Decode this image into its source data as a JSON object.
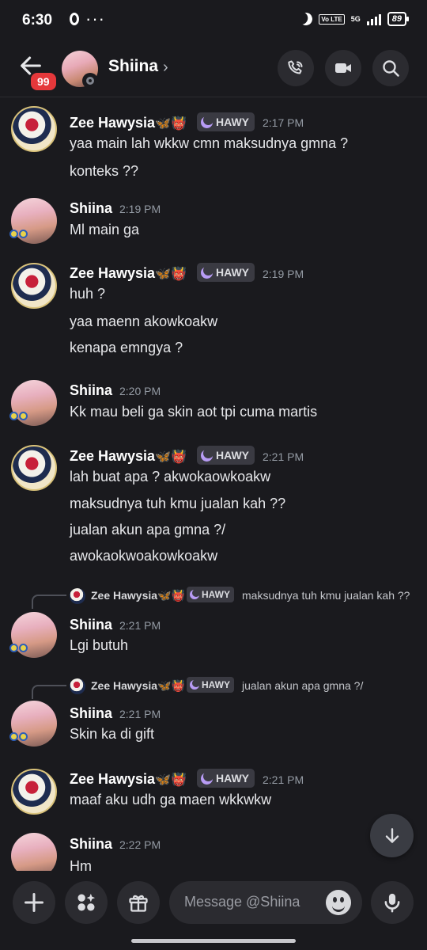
{
  "status_bar": {
    "time": "6:30",
    "dots": "···",
    "volte": "Vo LTE",
    "network": "5G",
    "battery": "89"
  },
  "header": {
    "back_badge": "99",
    "title": "Shiina",
    "chevron": "›"
  },
  "messages": [
    {
      "author": "Zee Hawysia",
      "emoji": "🦋👹",
      "tag": "HAWY",
      "time": "2:17 PM",
      "lines": [
        "yaa main lah wkkw cmn maksudnya gmna ?",
        "konteks ??"
      ]
    },
    {
      "author": "Shiina",
      "time": "2:19 PM",
      "lines": [
        "Ml main ga"
      ]
    },
    {
      "author": "Zee Hawysia",
      "emoji": "🦋👹",
      "tag": "HAWY",
      "time": "2:19 PM",
      "lines": [
        "huh ?",
        "yaa maenn akowkoakw",
        "kenapa emngya ?"
      ]
    },
    {
      "author": "Shiina",
      "time": "2:20 PM",
      "lines": [
        "Kk mau beli ga skin aot tpi cuma martis"
      ]
    },
    {
      "author": "Zee Hawysia",
      "emoji": "🦋👹",
      "tag": "HAWY",
      "time": "2:21 PM",
      "lines": [
        "lah buat apa ? akwokaowkoakw",
        "maksudnya tuh kmu jualan kah ??",
        "jualan akun apa gmna ?/",
        "awokaokwoakowkoakw"
      ]
    },
    {
      "author": "Shiina",
      "time": "2:21 PM",
      "lines": [
        "Lgi butuh"
      ],
      "reply": {
        "author": "Zee Hawysia",
        "emoji": "🦋👹",
        "tag": "HAWY",
        "text": "maksudnya tuh kmu jualan kah ??"
      }
    },
    {
      "author": "Shiina",
      "time": "2:21 PM",
      "lines": [
        "Skin ka di gift"
      ],
      "reply": {
        "author": "Zee Hawysia",
        "emoji": "🦋👹",
        "tag": "HAWY",
        "text": "jualan akun apa gmna ?/"
      }
    },
    {
      "author": "Zee Hawysia",
      "emoji": "🦋👹",
      "tag": "HAWY",
      "time": "2:21 PM",
      "lines": [
        "maaf aku udh ga maen wkkwkw"
      ]
    },
    {
      "author": "Shiina",
      "time": "2:22 PM",
      "lines": [
        "Hm"
      ]
    }
  ],
  "composer": {
    "placeholder": "Message @Shiina"
  },
  "colors": {
    "background": "#1a1a1e",
    "badge": "#e5383b",
    "tag_icon": "#b89cf5",
    "time": "#949ba4"
  },
  "icons": [
    "back-arrow",
    "call",
    "video",
    "search",
    "plus",
    "apps",
    "gift",
    "emoji",
    "microphone",
    "arrow-down"
  ]
}
